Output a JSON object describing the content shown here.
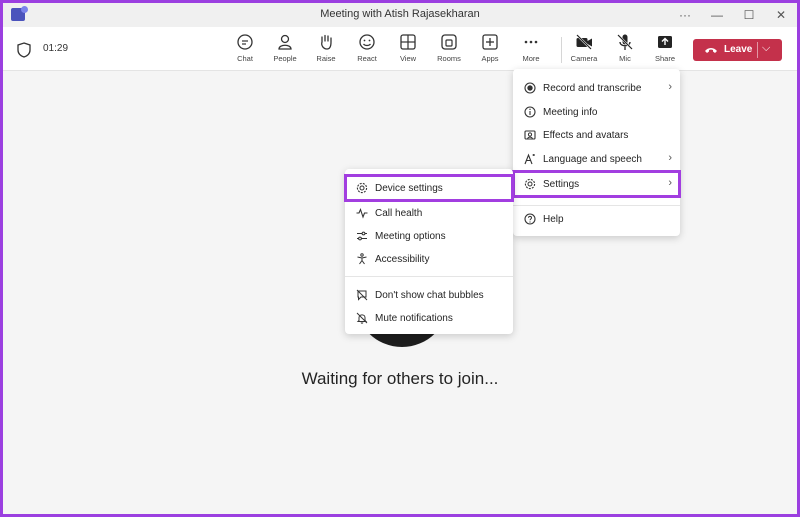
{
  "window": {
    "title": "Meeting with Atish Rajasekharan",
    "controls": {
      "more": "···",
      "minimize": "—",
      "maximize": "☐",
      "close": "✕"
    }
  },
  "meeting": {
    "timer": "01:29"
  },
  "toolbar": {
    "items": [
      {
        "label": "Chat",
        "icon": "chat-icon"
      },
      {
        "label": "People",
        "icon": "people-icon"
      },
      {
        "label": "Raise",
        "icon": "raise-hand-icon"
      },
      {
        "label": "React",
        "icon": "react-icon"
      },
      {
        "label": "View",
        "icon": "view-icon"
      },
      {
        "label": "Rooms",
        "icon": "rooms-icon"
      },
      {
        "label": "Apps",
        "icon": "apps-icon"
      },
      {
        "label": "More",
        "icon": "more-icon"
      },
      {
        "label": "Camera",
        "icon": "camera-off-icon"
      },
      {
        "label": "Mic",
        "icon": "mic-off-icon"
      },
      {
        "label": "Share",
        "icon": "share-icon"
      }
    ],
    "leave_label": "Leave",
    "leave_color": "#c4314b"
  },
  "stage": {
    "waiting_text": "Waiting for others to join..."
  },
  "more_menu": {
    "items": [
      {
        "label": "Record and transcribe",
        "icon": "record-icon",
        "submenu": true
      },
      {
        "label": "Meeting info",
        "icon": "info-icon",
        "submenu": false
      },
      {
        "label": "Effects and avatars",
        "icon": "effects-icon",
        "submenu": false
      },
      {
        "label": "Language and speech",
        "icon": "language-icon",
        "submenu": true
      },
      {
        "label": "Settings",
        "icon": "gear-icon",
        "submenu": true,
        "highlighted": true
      },
      {
        "label": "Help",
        "icon": "help-icon",
        "submenu": false
      }
    ]
  },
  "settings_menu": {
    "items": [
      {
        "label": "Device settings",
        "icon": "gear-icon",
        "highlighted": true
      },
      {
        "label": "Call health",
        "icon": "pulse-icon"
      },
      {
        "label": "Meeting options",
        "icon": "sliders-icon"
      },
      {
        "label": "Accessibility",
        "icon": "accessibility-icon"
      },
      {
        "label": "Don't show chat bubbles",
        "icon": "chat-off-icon"
      },
      {
        "label": "Mute notifications",
        "icon": "bell-off-icon"
      }
    ]
  },
  "colors": {
    "highlight": "#a23ee0",
    "accent": "#5b5fc7"
  }
}
